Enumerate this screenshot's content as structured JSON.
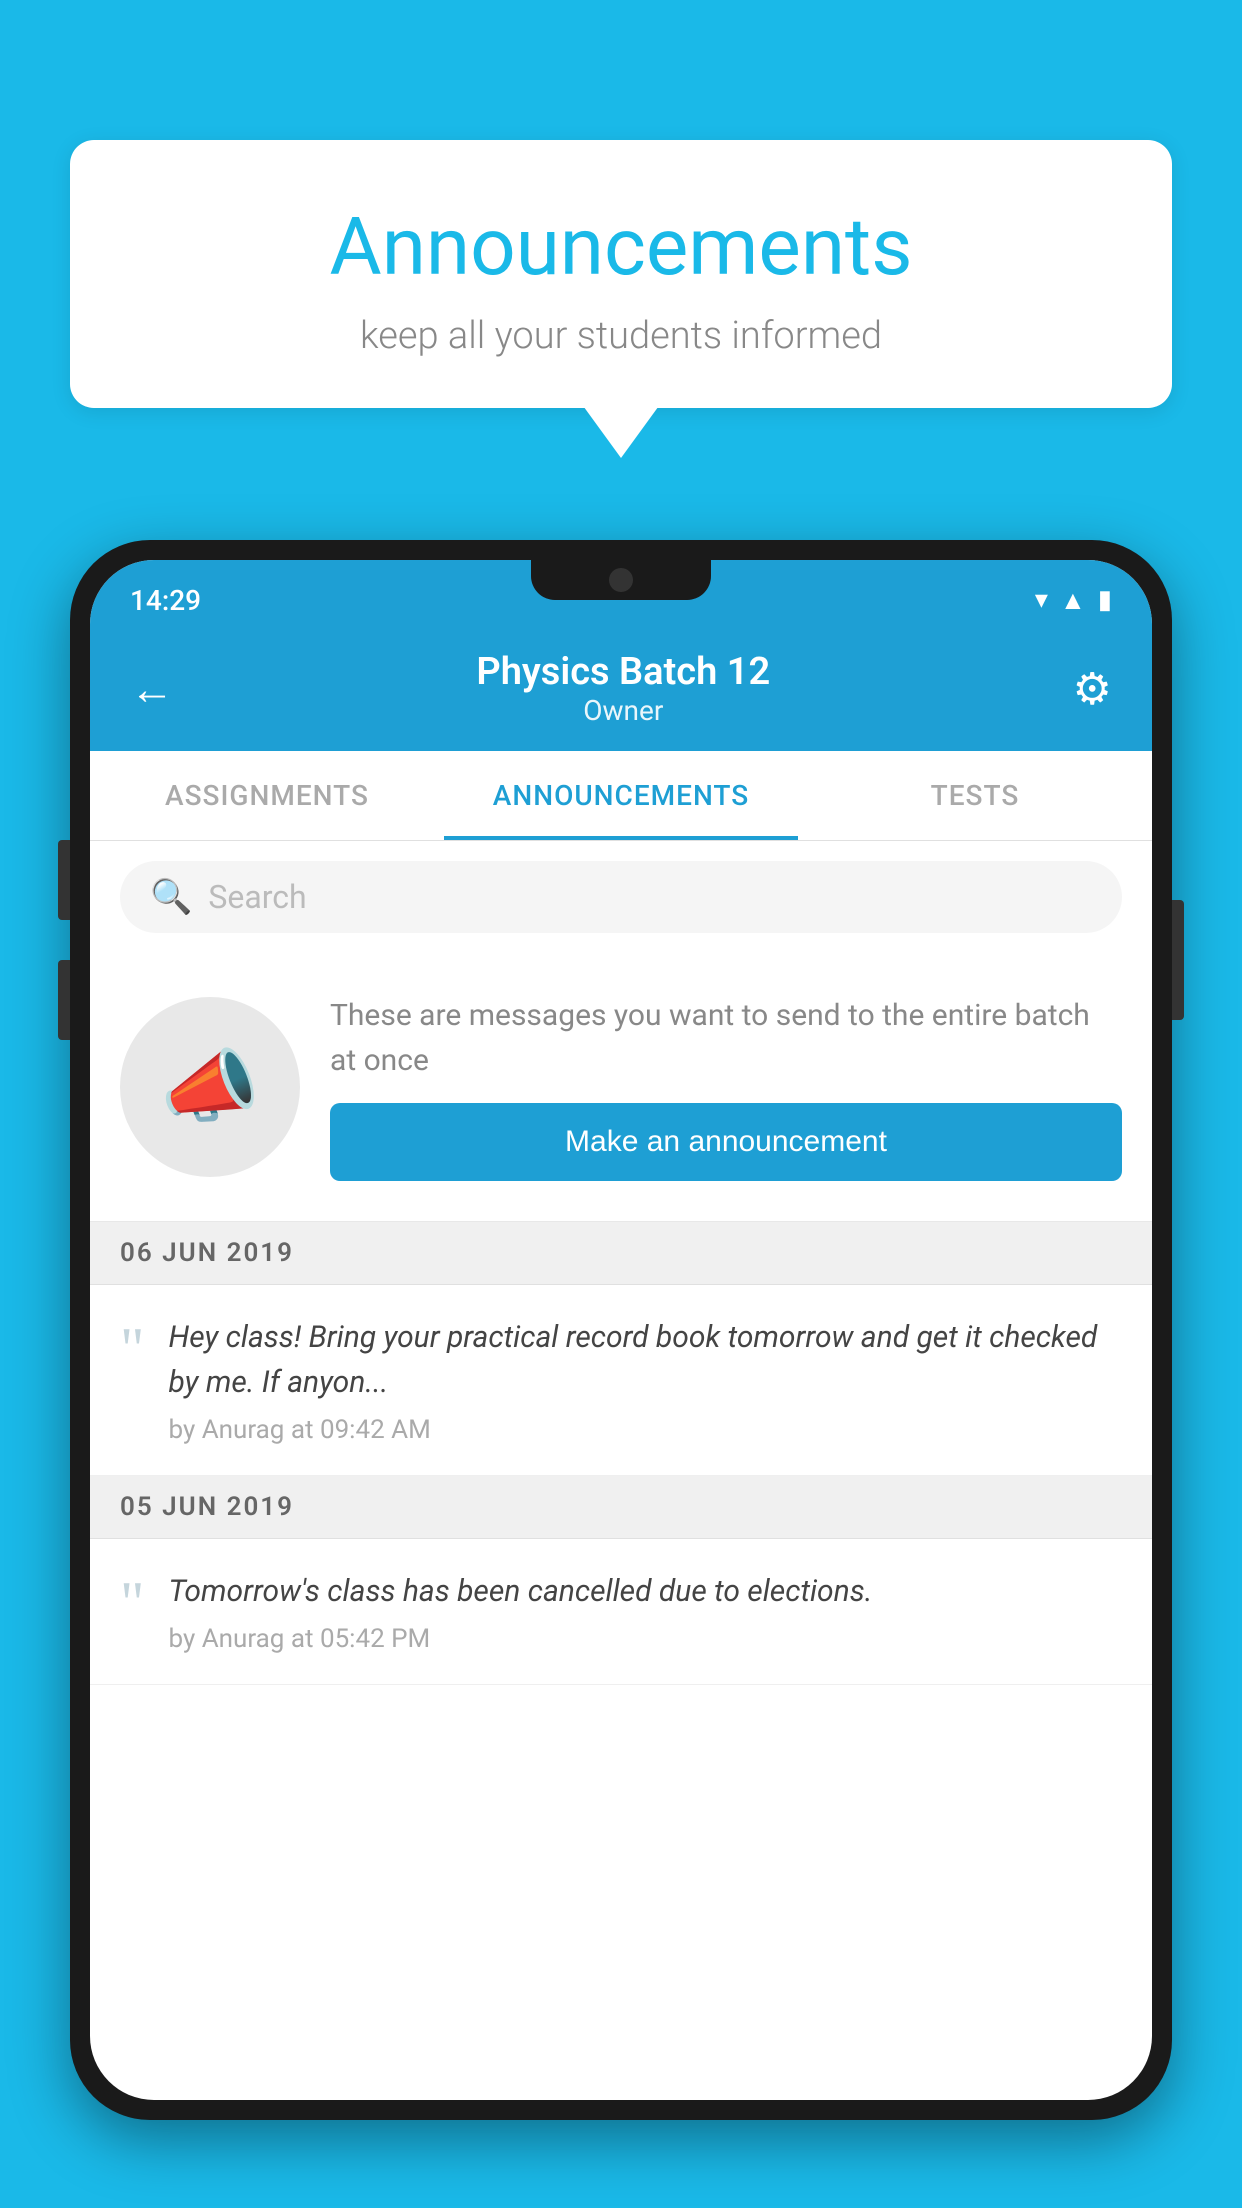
{
  "background_color": "#1ab9e8",
  "speech_bubble": {
    "title": "Announcements",
    "subtitle": "keep all your students informed"
  },
  "status_bar": {
    "time": "14:29",
    "icons": [
      "wifi",
      "signal",
      "battery"
    ]
  },
  "header": {
    "title": "Physics Batch 12",
    "subtitle": "Owner",
    "back_label": "←",
    "settings_label": "⚙"
  },
  "tabs": [
    {
      "label": "ASSIGNMENTS",
      "active": false
    },
    {
      "label": "ANNOUNCEMENTS",
      "active": true
    },
    {
      "label": "TESTS",
      "active": false
    }
  ],
  "search": {
    "placeholder": "Search"
  },
  "announcement_prompt": {
    "description": "These are messages you want to send to the entire batch at once",
    "button_label": "Make an announcement"
  },
  "date_groups": [
    {
      "date": "06  JUN  2019",
      "items": [
        {
          "text": "Hey class! Bring your practical record book tomorrow and get it checked by me. If anyon...",
          "meta": "by Anurag at 09:42 AM"
        }
      ]
    },
    {
      "date": "05  JUN  2019",
      "items": [
        {
          "text": "Tomorrow's class has been cancelled due to elections.",
          "meta": "by Anurag at 05:42 PM"
        }
      ]
    }
  ]
}
